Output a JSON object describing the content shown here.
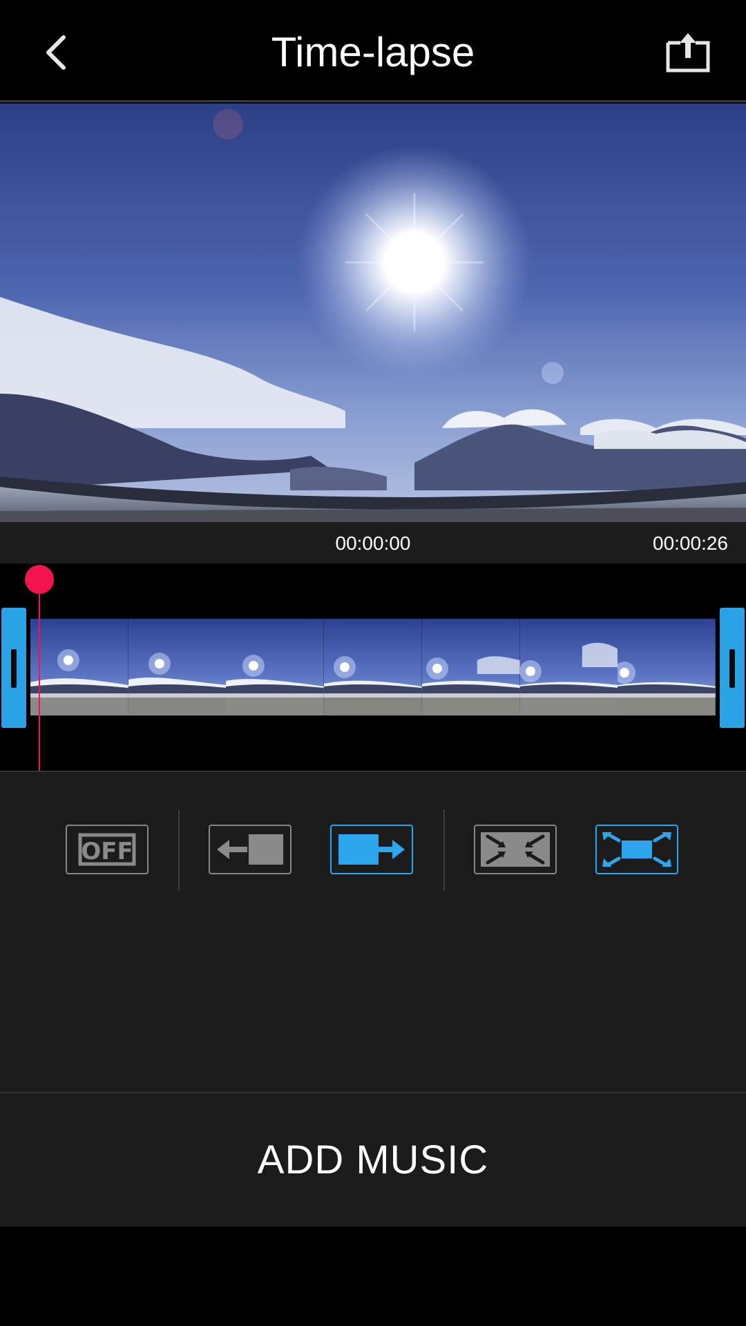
{
  "header": {
    "title": "Time-lapse",
    "back_icon": "chevron-left-icon",
    "share_icon": "share-upload-icon"
  },
  "player": {
    "current_time": "00:00:00",
    "end_time": "00:00:26"
  },
  "timeline": {
    "frame_count": 7,
    "playhead_color": "#f2134f",
    "handle_color": "#2aa3e6"
  },
  "effects": [
    {
      "name": "off",
      "icon": "off-icon",
      "label": "OFF",
      "selected": false
    },
    {
      "name": "pan-left",
      "icon": "slide-left-icon",
      "selected": false
    },
    {
      "name": "pan-right",
      "icon": "slide-right-icon",
      "selected": true
    },
    {
      "name": "zoom-in",
      "icon": "zoom-in-icon",
      "selected": false
    },
    {
      "name": "zoom-out",
      "icon": "zoom-out-icon",
      "selected": true
    }
  ],
  "footer": {
    "add_music_label": "ADD MUSIC"
  },
  "colors": {
    "accent": "#2ea6ef",
    "inactive": "#888888",
    "background": "#1b1b1b"
  }
}
